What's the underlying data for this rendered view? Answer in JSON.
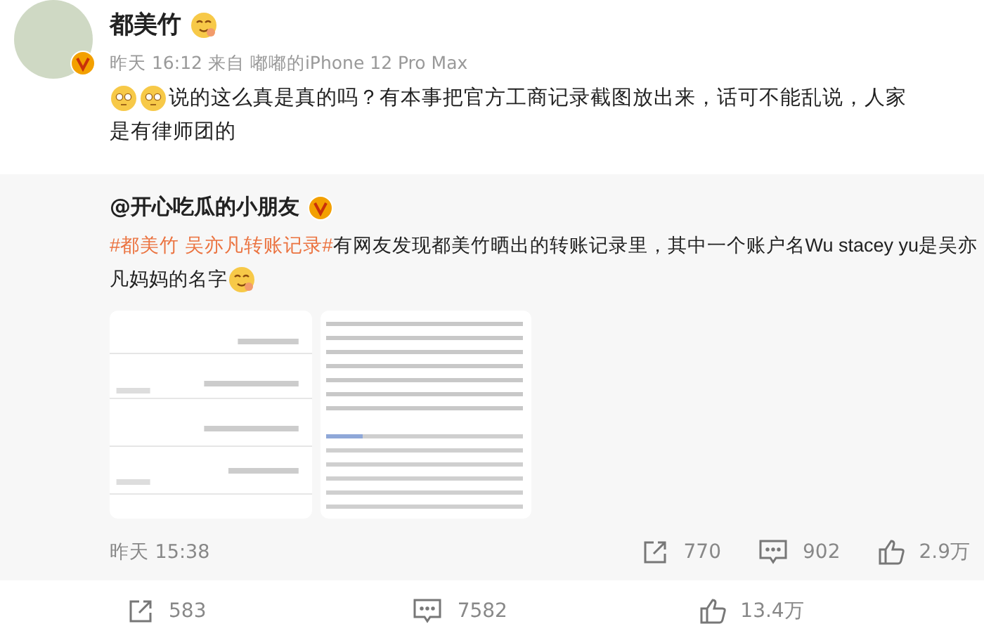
{
  "post": {
    "author": "都美竹",
    "meta": "昨天 16:12  来自 嘟嘟的iPhone 12 Pro Max",
    "text_lines": [
      "说的这么真是真的吗？有本事把官方工商记录截图放出来，话可不能乱说，人家",
      "是有律师团的"
    ],
    "repost": {
      "author": "@开心吃瓜的小朋友",
      "hashtag": "#都美竹 吴亦凡转账记录#",
      "text_lines": [
        "有网友发现都美竹晒出的转账记录里，其中一个账户名Wu stacey yu是吴亦",
        "凡妈妈的名字"
      ],
      "time": "昨天 15:38",
      "shares": "770",
      "comments": "902",
      "likes": "2.9万"
    },
    "shares": "583",
    "comments": "7582",
    "likes": "13.4万"
  }
}
